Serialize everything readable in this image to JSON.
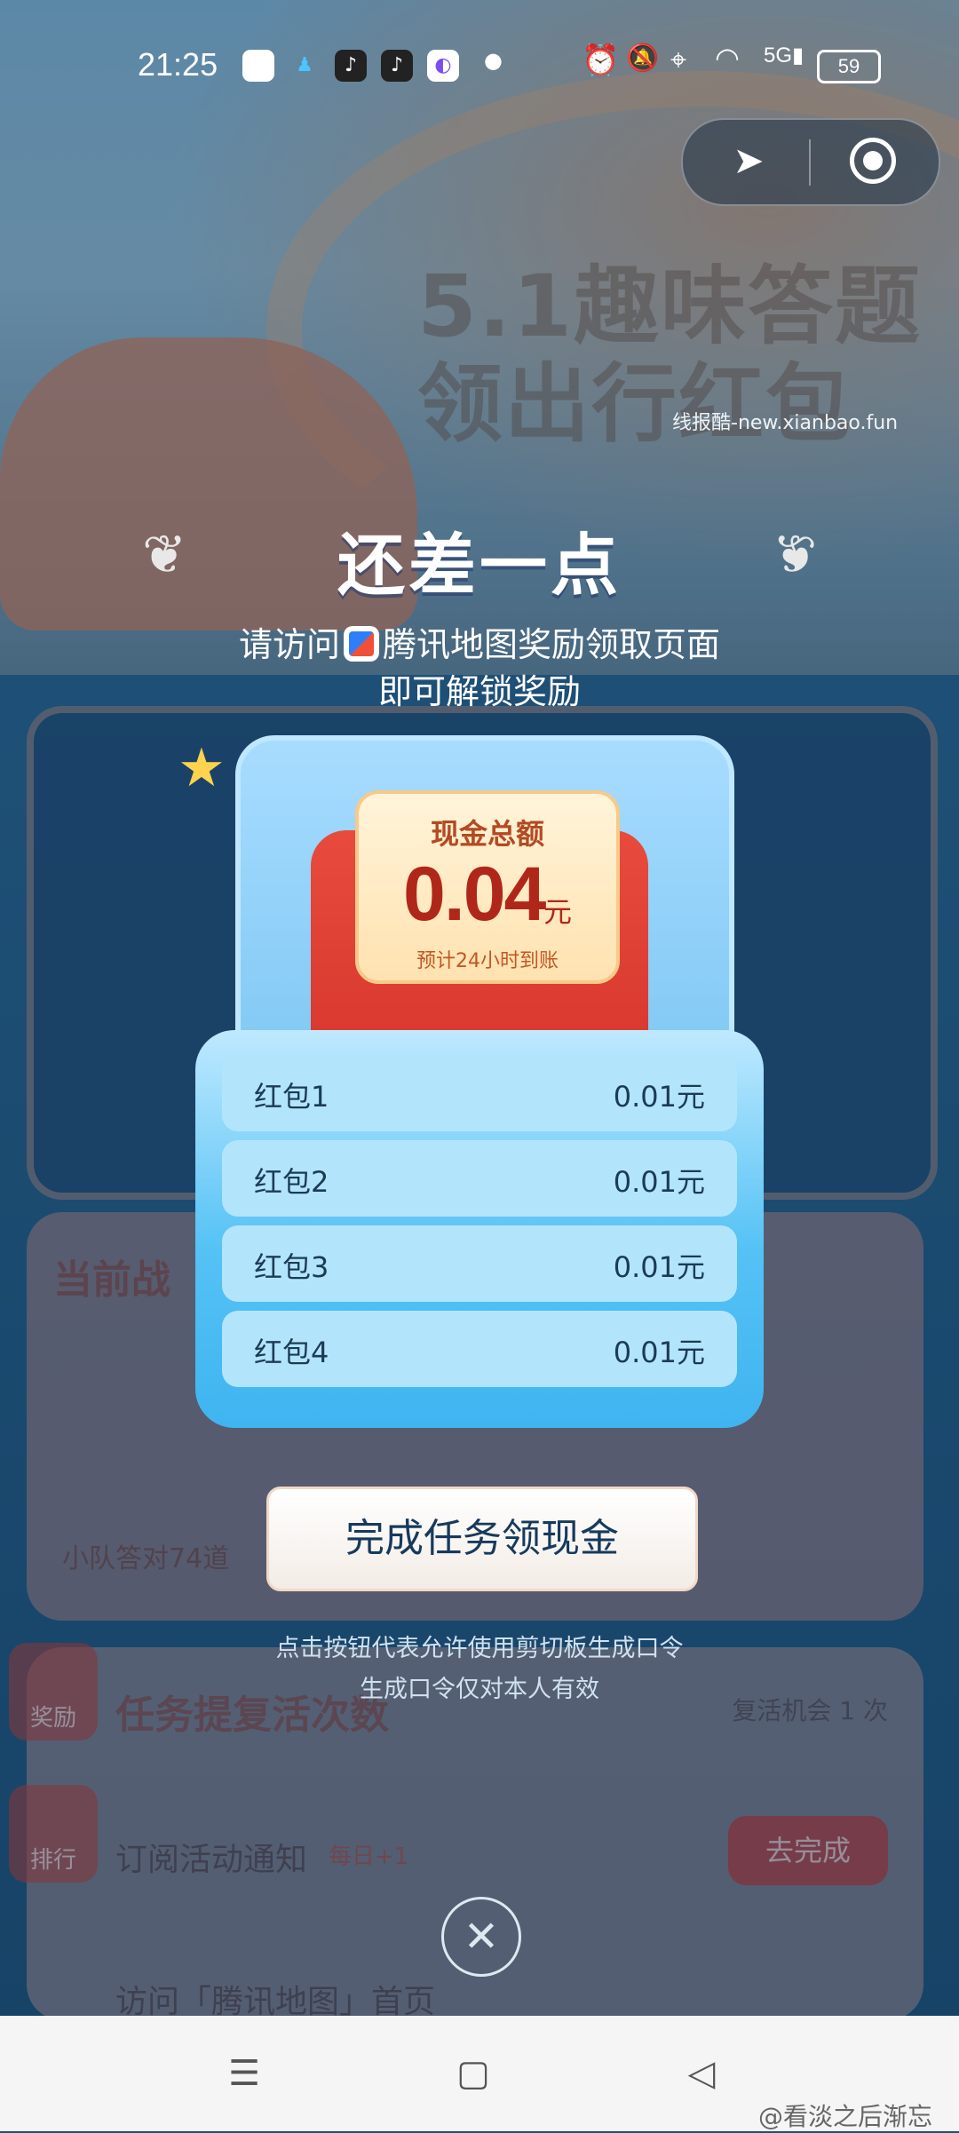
{
  "status_bar": {
    "time": "21:25",
    "battery": "59",
    "notification_icons": [
      "app-icon",
      "qq-icon",
      "tiktok-icon",
      "tiktok-icon",
      "browser-icon"
    ],
    "right_icons": [
      "alarm-icon",
      "mute-icon",
      "location-icon",
      "wifi-icon",
      "signal-5g-icon"
    ]
  },
  "capsule": {
    "left_icon": "location-arrow-icon",
    "right_icon": "target-icon"
  },
  "background": {
    "hero_title": "5.1趣味答题\n领出行红包",
    "section_title": "当前战",
    "task_title": "任务提复活次数",
    "task_item_1": "订阅活动通知",
    "task_item_1_badge": "每日+1",
    "task_item_2": "访问「腾讯地图」首页",
    "task_button": "去完成",
    "team_text": "小队答对74道",
    "revive": "复活机会 1 次",
    "side_reward": "奖励",
    "side_rank": "排行"
  },
  "watermark_top": "线报酷-new.xianbao.fun",
  "modal": {
    "title": "还差一点",
    "subtitle_prefix": "请访问",
    "subtitle_app": "腾讯地图奖励领取页面",
    "subtitle_line2": "即可解锁奖励",
    "ticket_title": "现金总额",
    "amount": "0.04",
    "unit": "元",
    "eta": "预计24小时到账",
    "items": [
      {
        "label": "红包1",
        "value": "0.01元"
      },
      {
        "label": "红包2",
        "value": "0.01元"
      },
      {
        "label": "红包3",
        "value": "0.01元"
      },
      {
        "label": "红包4",
        "value": "0.01元"
      }
    ],
    "cta": "完成任务领现金",
    "hint_line1": "点击按钮代表允许使用剪切板生成口令",
    "hint_line2": "生成口令仅对本人有效"
  },
  "watermark": "@看淡之后渐忘"
}
